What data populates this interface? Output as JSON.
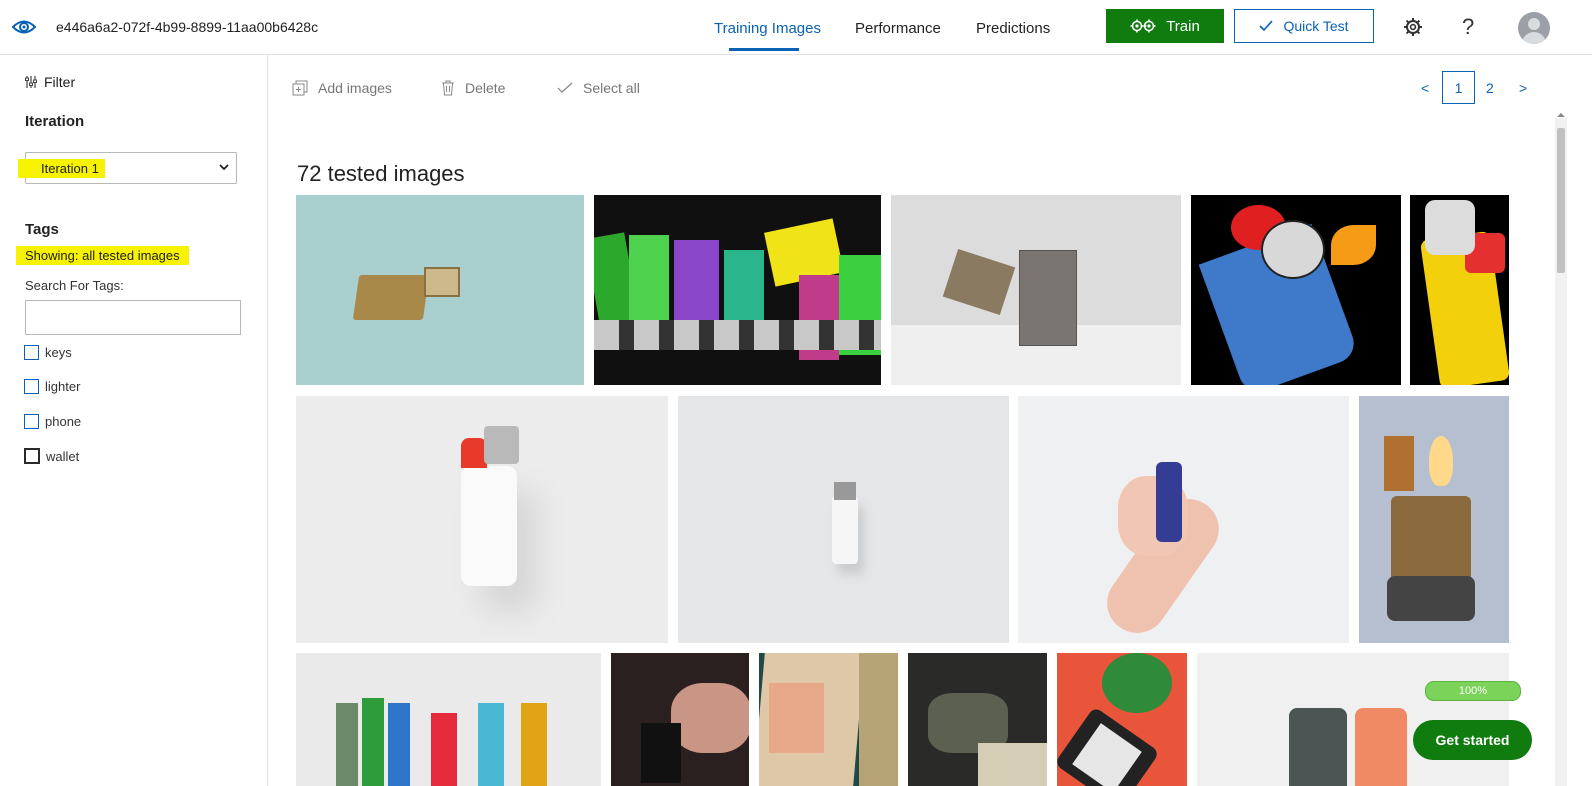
{
  "header": {
    "project_id": "e446a6a2-072f-4b99-8899-11aa00b6428c",
    "tabs": [
      {
        "label": "Training Images",
        "active": true
      },
      {
        "label": "Performance",
        "active": false
      },
      {
        "label": "Predictions",
        "active": false
      }
    ],
    "train_label": "Train",
    "quick_test_label": "Quick Test",
    "help_label": "?",
    "accent_color": "#0a62b4",
    "train_color": "#107c10"
  },
  "sidebar": {
    "filter_label": "Filter",
    "iteration_heading": "Iteration",
    "iteration_selected": "Iteration 1",
    "tags_heading": "Tags",
    "showing_text": "Showing: all tested images",
    "search_label": "Search For Tags:",
    "search_value": "",
    "tags": [
      {
        "label": "keys",
        "checked": false
      },
      {
        "label": "lighter",
        "checked": false
      },
      {
        "label": "phone",
        "checked": false
      },
      {
        "label": "wallet",
        "checked": false
      }
    ]
  },
  "toolbar": {
    "add_images": "Add images",
    "delete": "Delete",
    "select_all": "Select all"
  },
  "pagination": {
    "prev": "<",
    "pages": [
      "1",
      "2"
    ],
    "current": "1",
    "next": ">"
  },
  "main": {
    "heading": "72 tested images"
  },
  "widget": {
    "progress": "100%",
    "get_started": "Get started"
  },
  "icons": [
    "eye-icon",
    "gear-pair-icon",
    "checkmark-icon",
    "settings-gear-icon",
    "help-icon",
    "avatar",
    "filter-sliders-icon",
    "chevron-down-icon",
    "add-image-icon",
    "trash-icon",
    "check-icon"
  ]
}
